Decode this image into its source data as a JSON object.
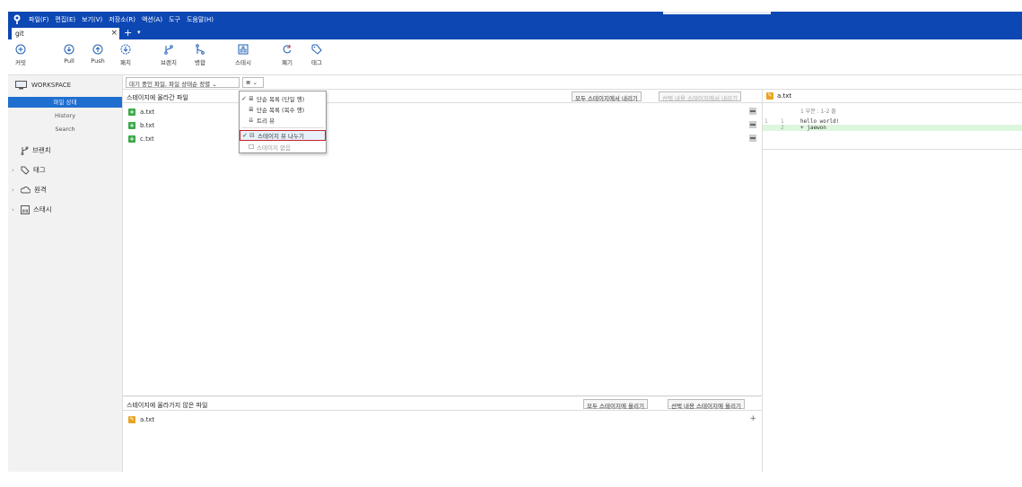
{
  "app": {
    "menu": [
      "파일(F)",
      "편집(E)",
      "보기(V)",
      "저장소(R)",
      "액션(A)",
      "도구",
      "도움말(H)"
    ],
    "tab": {
      "label": "git",
      "close": "×"
    },
    "new_tab": "+",
    "tab_dropdown": "▾"
  },
  "toolbar": {
    "commit": "커밋",
    "pull": "Pull",
    "push": "Push",
    "fetch": "패치",
    "branch": "브랜치",
    "merge": "병합",
    "stash": "스태시",
    "discard": "폐기",
    "tag": "태그"
  },
  "sidebar": {
    "workspace": "WORKSPACE",
    "items": [
      {
        "label": "파일 상태",
        "selected": true
      },
      {
        "label": "History",
        "selected": false
      },
      {
        "label": "Search",
        "selected": false
      }
    ],
    "branches": "브랜치",
    "tags": "태그",
    "remotes": "원격",
    "stashes": "스태시",
    "collapse": "›"
  },
  "filter": {
    "sort_label": "대기 중인 파일, 파일 상태순 정렬 ⌄",
    "view_label": "≣ ⌄"
  },
  "dropdown": {
    "items": [
      {
        "check": "✓",
        "icon": "≣",
        "label": "단순 목록 (단일 행)",
        "state": "normal"
      },
      {
        "check": "",
        "icon": "≣",
        "label": "단순 목록 (복수 행)",
        "state": "normal"
      },
      {
        "check": "",
        "icon": "⇊",
        "label": "트리 뷰",
        "state": "normal"
      },
      {
        "check": "✓",
        "icon": "⊟",
        "label": "스테이지 뷰 나누기",
        "state": "selected"
      },
      {
        "check": "",
        "icon": "☐",
        "label": "스테이지 없음",
        "state": "disabled"
      }
    ]
  },
  "staged": {
    "title": "스테이지에 올라간 파일",
    "unstage_all": "모두 스테이지에서 내리기",
    "unstage_selected": "선택 내용 스테이지에서 내리기",
    "files": [
      "a.txt",
      "b.txt",
      "c.txt"
    ]
  },
  "unstaged": {
    "title": "스테이지에 올라가지 않은 파일",
    "stage_all": "모두 스테이지에 올리기",
    "stage_selected": "선택 내용 스테이지에 올리기",
    "files": [
      "a.txt"
    ],
    "add": "+"
  },
  "diff": {
    "file": "a.txt",
    "hunk": "1 부분 : 1-2 줄",
    "lines": [
      {
        "old": "1",
        "new": "1",
        "code": "  hello world!"
      },
      {
        "old": "",
        "new": "2",
        "code": "+ jaewon"
      }
    ]
  },
  "colors": {
    "titlebar": "#0d47b4",
    "selected_nav": "#1f6fd0",
    "added_badge": "#3aa845",
    "modified_badge": "#e8a422",
    "highlight_border": "#c0262a",
    "added_line": "#ddf7de"
  }
}
